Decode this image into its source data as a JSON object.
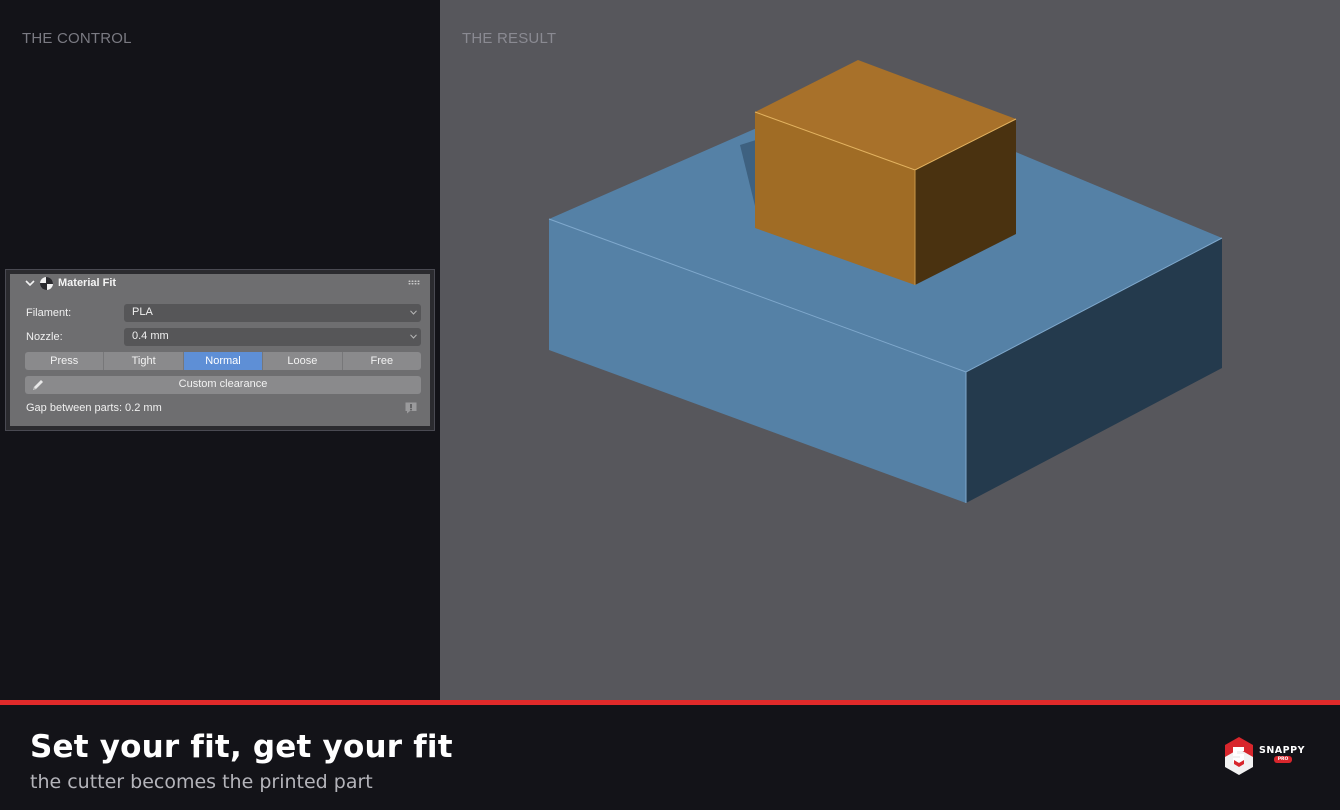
{
  "labels": {
    "control": "THE CONTROL",
    "result": "THE RESULT"
  },
  "panel": {
    "title": "Material Fit",
    "filament_label": "Filament:",
    "filament_value": "PLA",
    "nozzle_label": "Nozzle:",
    "nozzle_value": "0.4 mm",
    "fit_options": [
      "Press",
      "Tight",
      "Normal",
      "Loose",
      "Free"
    ],
    "selected_fit": "Normal",
    "custom_button": "Custom clearance",
    "gap_text": "Gap between parts: 0.2 mm"
  },
  "footer": {
    "headline": "Set your fit, get your fit",
    "subline": "the cutter becomes the printed part"
  },
  "logo": {
    "name": "SNAPPY",
    "badge": "PRO"
  },
  "icons": {
    "collapse": "chevron-down-icon",
    "material": "material-icon",
    "drag": "grip-icon",
    "dropdown": "caret-down-icon",
    "edit": "pencil-icon",
    "info": "info-icon",
    "brand": "snappy-logo-icon"
  },
  "colors": {
    "accent_red": "#e02a2a",
    "active_segment": "#5e8fd6",
    "base_block": "#5581a6",
    "top_block": "#a06c25",
    "viewport_bg": "#57575c",
    "dark_bg": "#131318"
  }
}
